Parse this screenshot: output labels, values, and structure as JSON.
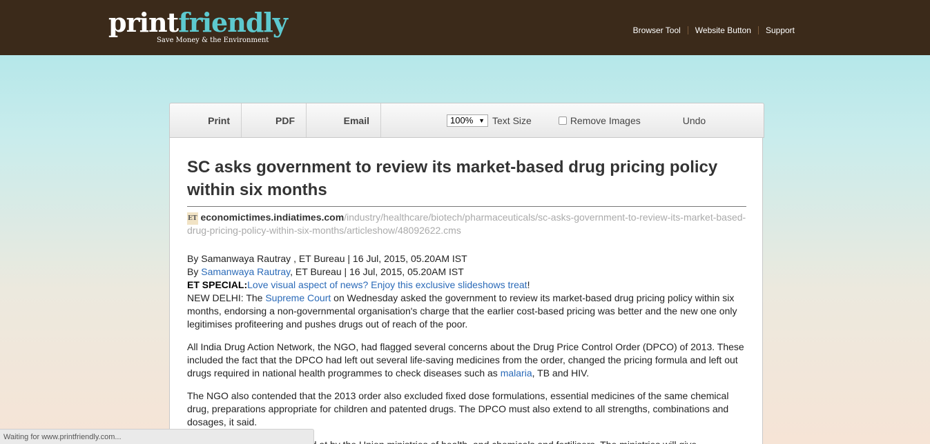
{
  "header": {
    "logo_print": "print",
    "logo_friendly": "friendly",
    "tagline": "Save Money & the Environment",
    "nav": [
      "Browser Tool",
      "Website Button",
      "Support"
    ]
  },
  "toolbar": {
    "print_label": "Print",
    "pdf_label": "PDF",
    "email_label": "Email",
    "zoom_value": "100%",
    "text_size_label": "Text Size",
    "remove_images_label": "Remove Images",
    "undo_label": "Undo"
  },
  "article": {
    "title": "SC asks government to review its market-based drug pricing policy within six months",
    "source_badge": "ET",
    "source_domain": "economictimes.indiatimes.com",
    "source_path": "/industry/healthcare/biotech/pharmaceuticals/sc-asks-government-to-review-its-market-based-drug-pricing-policy-within-six-months/articleshow/48092622.cms",
    "byline1": "By Samanwaya Rautray , ET Bureau | 16 Jul, 2015, 05.20AM IST",
    "byline2_prefix": "By ",
    "byline2_author": "Samanwaya Rautray",
    "byline2_suffix": ", ET Bureau | 16 Jul, 2015, 05.20AM IST",
    "special_label": "ET SPECIAL:",
    "special_link": "Love visual aspect of news? Enjoy this exclusive slideshows treat",
    "special_end": "!",
    "p1_a": "NEW DELHI: The ",
    "p1_link": "Supreme Court",
    "p1_b": " on Wednesday asked the government to review its market-based drug pricing policy within six months, endorsing a non-governmental organisation's charge that the earlier cost-based pricing was better and the new one only legitimises profiteering and pushes drugs out of reach of the poor.",
    "p2_a": "All India Drug Action Network, the NGO, had flagged several concerns about the Drug Price Control Order (DPCO) of 2013. These included the fact that the DPCO had left out several life-saving medicines from the order, changed the pricing formula and left out drugs required in national health programmes to check diseases such as ",
    "p2_link": "malaria",
    "p2_b": ", TB and HIV.",
    "p3": "The NGO also contended that the 2013 order also excluded fixed dose formulations, essential medicines of the same chemical drug, preparations appropriate for children and patented drugs. The DPCO must also extend to all strengths, combinations and dosages, it said.",
    "p4": "These concerns will be looked at by the Union ministries of health, and chemicals and fertilisers. The ministries will give"
  },
  "status": {
    "text": "Waiting for www.printfriendly.com..."
  }
}
